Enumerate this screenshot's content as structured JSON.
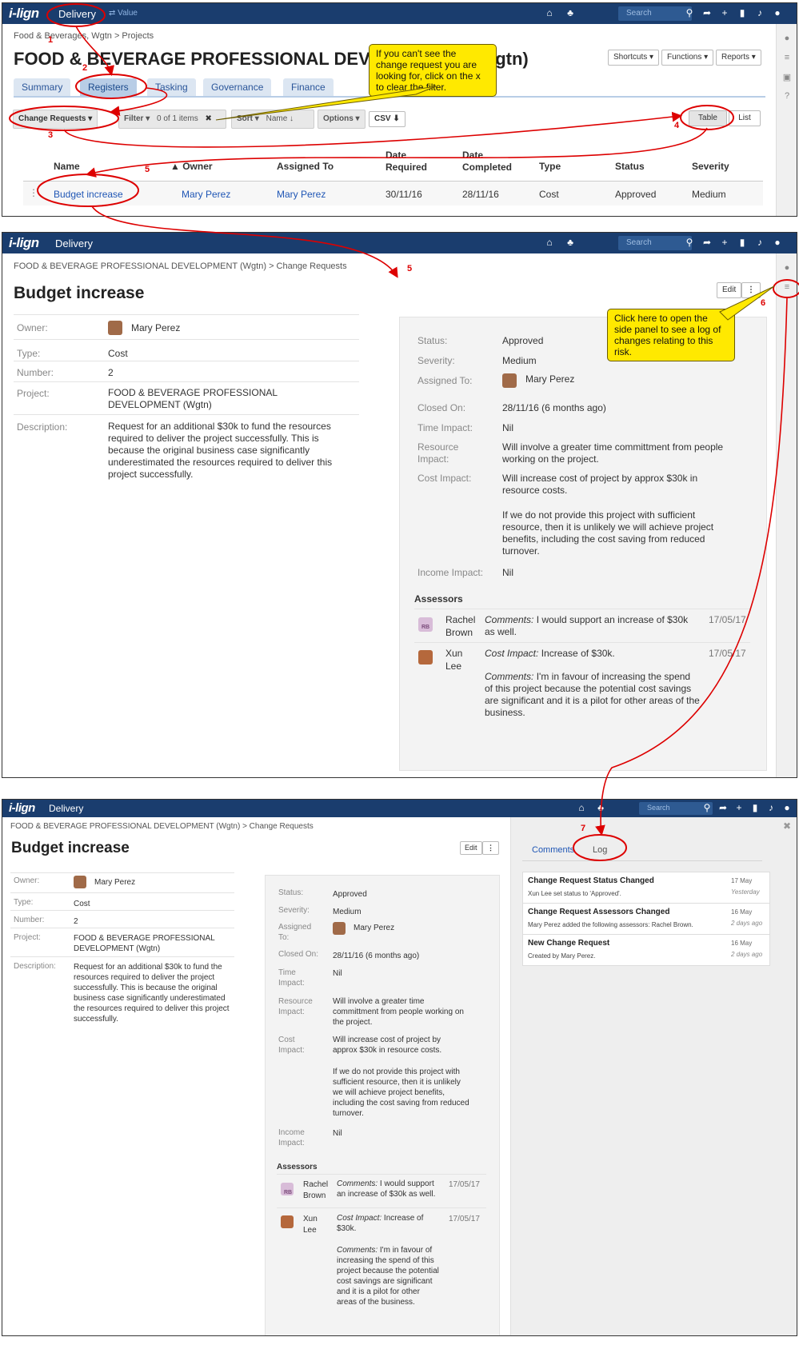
{
  "app": {
    "logo": "i-lign",
    "name": "Delivery",
    "switch": "⇄ Value",
    "search_placeholder": "Search"
  },
  "panel1": {
    "breadcrumb": "Food & Beverages, Wgtn > Projects",
    "title": "FOOD & BEVERAGE PROFESSIONAL DEVELOPMENT (Wgtn)",
    "shortcuts": "Shortcuts ▾",
    "functions": "Functions ▾",
    "reports": "Reports ▾",
    "tabs": [
      "Summary",
      "Registers",
      "Tasking",
      "Governance",
      "Finance"
    ],
    "toolbar": {
      "change_requests": "Change Requests ▾",
      "filter": "Filter ▾",
      "filter_count": "0 of 1 items",
      "clear": "✖",
      "sort": "Sort ▾",
      "sort_field": "Name ↓",
      "options": "Options ▾",
      "csv": "CSV ⬇",
      "table": "Table",
      "list": "List"
    },
    "headers": {
      "name": "Name",
      "owner": "Owner",
      "assigned": "Assigned To",
      "date_required": "Date Required",
      "date_completed": "Date Completed",
      "type": "Type",
      "status": "Status",
      "severity": "Severity"
    },
    "row": {
      "name": "Budget increase",
      "owner": "Mary Perez",
      "assigned": "Mary Perez",
      "date_required": "30/11/16",
      "date_completed": "28/11/16",
      "type": "Cost",
      "status": "Approved",
      "severity": "Medium"
    },
    "callout": "If you can't see the change request you are looking for, click on the x to clear the filter."
  },
  "record": {
    "breadcrumb": "FOOD & BEVERAGE PROFESSIONAL DEVELOPMENT (Wgtn) > Change Requests",
    "title": "Budget increase",
    "edit": "Edit",
    "more": "⋮",
    "labels": {
      "owner": "Owner:",
      "type": "Type:",
      "number": "Number:",
      "project": "Project:",
      "description": "Description:",
      "status": "Status:",
      "severity": "Severity:",
      "assigned": "Assigned To:",
      "closed": "Closed On:",
      "time": "Time Impact:",
      "resource": "Resource Impact:",
      "cost": "Cost Impact:",
      "income": "Income Impact:",
      "assessors": "Assessors"
    },
    "owner": "Mary Perez",
    "type": "Cost",
    "number": "2",
    "project": "FOOD & BEVERAGE PROFESSIONAL DEVELOPMENT (Wgtn)",
    "description": "Request for an additional $30k to fund the resources required to deliver the project successfully. This is because the original business case significantly underestimated the resources required to deliver this project successfully.",
    "status": "Approved",
    "severity": "Medium",
    "assigned": "Mary Perez",
    "closed": "28/11/16 (6 months ago)",
    "time": "Nil",
    "resource": "Will involve a greater time committment from people working on the project.",
    "cost1": "Will increase cost of project by approx $30k in resource costs.",
    "cost2": "If we do not provide this project with sufficient resource, then it is unlikely we will achieve project benefits, including the cost saving from reduced turnover.",
    "income": "Nil",
    "assessor1": {
      "first": "Rachel",
      "last": "Brown",
      "initials": "RB",
      "label": "Comments:",
      "text": "I would support an increase of $30k as well.",
      "date": "17/05/17"
    },
    "assessor2": {
      "first": "Xun",
      "last": "Lee",
      "label1": "Cost Impact:",
      "text1": "Increase of $30k.",
      "label2": "Comments:",
      "text2": "I'm in favour of increasing the spend of this project because the potential cost savings are significant and it is a pilot for other areas of the business.",
      "date": "17/05/17"
    },
    "callout": "Click here to open the side panel to see a log of changes relating to this risk."
  },
  "sidepanel": {
    "tabs": [
      "Comments",
      "Log"
    ],
    "log": [
      {
        "title": "Change Request Status Changed",
        "text": "Xun Lee set status to 'Approved'.",
        "date": "17 May",
        "ago": "Yesterday"
      },
      {
        "title": "Change Request Assessors Changed",
        "text": "Mary Perez added the following assessors: Rachel Brown.",
        "date": "16 May",
        "ago": "2 days ago"
      },
      {
        "title": "New Change Request",
        "text": "Created by Mary Perez.",
        "date": "16 May",
        "ago": "2 days ago"
      }
    ]
  },
  "steps": [
    "1",
    "2",
    "3",
    "4",
    "5",
    "5",
    "6",
    "7"
  ]
}
